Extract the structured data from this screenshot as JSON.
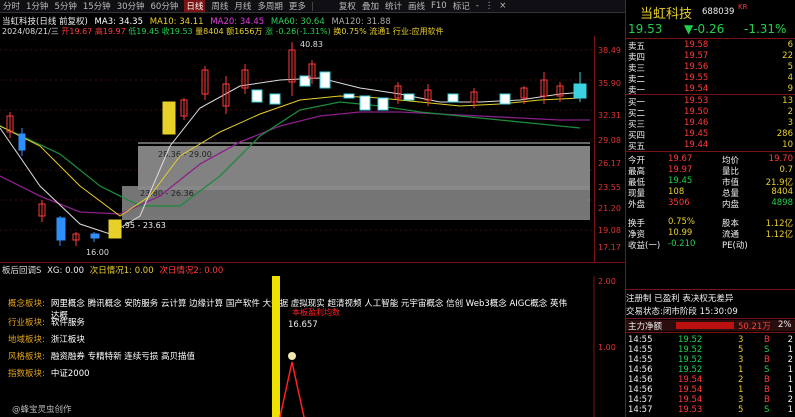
{
  "toolbar": {
    "periods": [
      "分时",
      "1分钟",
      "5分钟",
      "15分钟",
      "30分钟",
      "60分钟",
      "日线",
      "周线",
      "月线",
      "多周期",
      "更多"
    ],
    "active": "日线",
    "right": [
      "复权",
      "叠加",
      "统计",
      "画线",
      "F10",
      "标记",
      "-",
      "⋮",
      "×"
    ]
  },
  "header": {
    "name": "当虹科技(日线 前复权)",
    "ma3": "MA3: 34.35",
    "ma10": "MA10: 34.11",
    "ma20": "MA20: 34.45",
    "ma60": "MA60: 30.64",
    "ma120": "MA120: 31.88",
    "date": "2024/08/21/三",
    "open": "开19.67",
    "high": "高19.97",
    "low": "低19.45",
    "close": "收19.53",
    "volume": "量8404",
    "amount": "额1656万",
    "change": "涨 -0.26(-1.31%)",
    "turnover": "换0.75%",
    "float": "流通1 行业:应用软件"
  },
  "axis": {
    "labels": [
      "38.49",
      "35.90",
      "32.31",
      "29.08",
      "26.17",
      "23.55",
      "21.20",
      "19.08",
      "17.17"
    ]
  },
  "annotations": {
    "high_marker": "40.83",
    "low_marker": "16.00",
    "band1": "28.36 - 29.00",
    "band2": "23.80 - 26.36",
    "band3": "19.95 - 23.63"
  },
  "sub": {
    "title": "板后回调S",
    "xg": "XG: 0.00",
    "prev1": "次日情况1: 0.00",
    "prev2": "次日情况2: 0.00",
    "rows": [
      {
        "label": "概念板块:",
        "value": "网里概念 腾讯概念 安防服务 云计算 边缘计算 国产软件 大数据 虚拟现实 超清视频 人工智能 元宇宙概念 信创 Web3概念 AIGC概念 英伟达概"
      },
      {
        "label": "行业板块:",
        "value": "软件服务"
      },
      {
        "label": "地域板块:",
        "value": "浙江板块"
      },
      {
        "label": "风格板块:",
        "value": "融资融券 专精特新 连续亏损 高贝描值"
      },
      {
        "label": "指数板块:",
        "value": "中证2000"
      }
    ],
    "profit_label": "本板盈利均数",
    "profit_value": "16.657",
    "watermark": "@蜂宝灵虫创作",
    "axis": [
      "2.00",
      "1.00"
    ]
  },
  "quote": {
    "name": "当虹科技",
    "code": "688039",
    "kr": "KR",
    "price": "19.53",
    "change": "▼-0.26",
    "pct": "-1.31%",
    "book": [
      {
        "l": "卖五",
        "p": "19.58",
        "v": "6"
      },
      {
        "l": "卖四",
        "p": "19.57",
        "v": "22"
      },
      {
        "l": "卖三",
        "p": "19.56",
        "v": "5"
      },
      {
        "l": "卖二",
        "p": "19.55",
        "v": "4"
      },
      {
        "l": "卖一",
        "p": "19.54",
        "v": "9"
      },
      {
        "l": "买一",
        "p": "19.53",
        "v": "13"
      },
      {
        "l": "买二",
        "p": "19.50",
        "v": "2"
      },
      {
        "l": "买三",
        "p": "19.46",
        "v": "3"
      },
      {
        "l": "买四",
        "p": "19.45",
        "v": "286"
      },
      {
        "l": "买五",
        "p": "19.44",
        "v": "10"
      }
    ],
    "stats": [
      {
        "l1": "今开",
        "v1": "19.67",
        "l2": "均价",
        "v2": "19.70"
      },
      {
        "l1": "最高",
        "v1": "19.97",
        "l2": "量比",
        "v2": "0.7"
      },
      {
        "l1": "最低",
        "v1": "19.45",
        "l2": "市值",
        "v2": "21.9亿"
      },
      {
        "l1": "现量",
        "v1": "108",
        "l2": "总量",
        "v2": "8404"
      },
      {
        "l1": "外盘",
        "v1": "3506",
        "l2": "内盘",
        "v2": "4898"
      },
      {
        "l1": "换手",
        "v1": "0.75%",
        "l2": "股本",
        "v2": "1.12亿"
      },
      {
        "l1": "净资",
        "v1": "10.99",
        "l2": "流通",
        "v2": "1.12亿"
      },
      {
        "l1": "收益(一)",
        "v1": "-0.210",
        "l2": "PE(动)",
        "v2": ""
      }
    ],
    "reg": "注册制 已盈利 表决权无差异",
    "status_label": "交易状态:",
    "status": "闭市阶段 15:30:09",
    "net_label": "主力净额",
    "net_value": "50.21万",
    "net_pct": "2%",
    "ticks": [
      {
        "t": "14:55",
        "p": "19.52",
        "v": "3",
        "s": "B",
        "n": "2"
      },
      {
        "t": "14:55",
        "p": "19.52",
        "v": "5",
        "s": "S",
        "n": "1"
      },
      {
        "t": "14:55",
        "p": "19.52",
        "v": "3",
        "s": "B",
        "n": "2"
      },
      {
        "t": "14:56",
        "p": "19.52",
        "v": "1",
        "s": "S",
        "n": "1"
      },
      {
        "t": "14:56",
        "p": "19.54",
        "v": "2",
        "s": "B",
        "n": "1"
      },
      {
        "t": "14:56",
        "p": "19.54",
        "v": "1",
        "s": "B",
        "n": "1"
      },
      {
        "t": "14:57",
        "p": "19.54",
        "v": "3",
        "s": "B",
        "n": "2"
      },
      {
        "t": "14:57",
        "p": "19.53",
        "v": "5",
        "s": "S",
        "n": "1"
      }
    ]
  }
}
